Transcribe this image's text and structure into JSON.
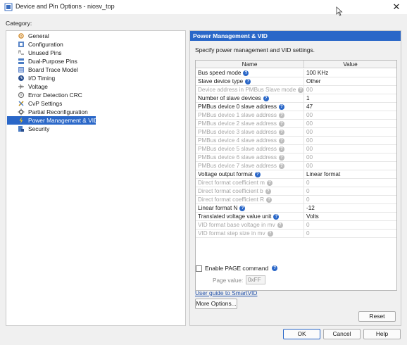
{
  "window": {
    "title": "Device and Pin Options - niosv_top",
    "close_glyph": "✕"
  },
  "category_label": "Category:",
  "tree": [
    {
      "label": "General",
      "icon": "general-icon",
      "selected": false
    },
    {
      "label": "Configuration",
      "icon": "configuration-icon",
      "selected": false
    },
    {
      "label": "Unused Pins",
      "icon": "unused-pins-icon",
      "selected": false
    },
    {
      "label": "Dual-Purpose Pins",
      "icon": "dual-purpose-pins-icon",
      "selected": false
    },
    {
      "label": "Board Trace Model",
      "icon": "board-trace-model-icon",
      "selected": false
    },
    {
      "label": "I/O Timing",
      "icon": "io-timing-icon",
      "selected": false
    },
    {
      "label": "Voltage",
      "icon": "voltage-icon",
      "selected": false
    },
    {
      "label": "Error Detection CRC",
      "icon": "error-detection-crc-icon",
      "selected": false
    },
    {
      "label": "CvP Settings",
      "icon": "cvp-settings-icon",
      "selected": false
    },
    {
      "label": "Partial Reconfiguration",
      "icon": "partial-reconfiguration-icon",
      "selected": false
    },
    {
      "label": "Power Management & VID",
      "icon": "power-management-icon",
      "selected": true
    },
    {
      "label": "Security",
      "icon": "security-icon",
      "selected": false
    }
  ],
  "panel": {
    "header": "Power Management & VID",
    "description": "Specify power management and VID settings.",
    "columns": {
      "name": "Name",
      "value": "Value"
    },
    "rows": [
      {
        "name": "Bus speed mode",
        "value": "100 KHz",
        "disabled": false
      },
      {
        "name": "Slave device type",
        "value": "Other",
        "disabled": false
      },
      {
        "name": "Device address in PMBus Slave mode",
        "value": "00",
        "disabled": true
      },
      {
        "name": "Number of slave devices",
        "value": "1",
        "disabled": false
      },
      {
        "name": "PMBus device 0 slave address",
        "value": "47",
        "disabled": false
      },
      {
        "name": "PMBus device 1 slave address",
        "value": "00",
        "disabled": true
      },
      {
        "name": "PMBus device 2 slave address",
        "value": "00",
        "disabled": true
      },
      {
        "name": "PMBus device 3 slave address",
        "value": "00",
        "disabled": true
      },
      {
        "name": "PMBus device 4 slave address",
        "value": "00",
        "disabled": true
      },
      {
        "name": "PMBus device 5 slave address",
        "value": "00",
        "disabled": true
      },
      {
        "name": "PMBus device 6 slave address",
        "value": "00",
        "disabled": true
      },
      {
        "name": "PMBus device 7 slave address",
        "value": "00",
        "disabled": true
      },
      {
        "name": "Voltage output format",
        "value": "Linear format",
        "disabled": false
      },
      {
        "name": "Direct format coefficient m",
        "value": "0",
        "disabled": true
      },
      {
        "name": "Direct format coefficient b",
        "value": "0",
        "disabled": true
      },
      {
        "name": "Direct format coefficient R",
        "value": "0",
        "disabled": true
      },
      {
        "name": "Linear format N",
        "value": "-12",
        "disabled": false
      },
      {
        "name": "Translated voltage value unit",
        "value": "Volts",
        "disabled": false
      },
      {
        "name": "VID format base voltage in mv",
        "value": "0",
        "disabled": true
      },
      {
        "name": "VID format step size in mv",
        "value": "0",
        "disabled": true
      }
    ],
    "enable_page_label": "Enable PAGE command",
    "page_value_label": "Page value:",
    "page_value": "0xFF",
    "guide_link": "User guide to SmartVID",
    "more_options": "More Options...",
    "reset": "Reset"
  },
  "footer": {
    "ok": "OK",
    "cancel": "Cancel",
    "help": "Help"
  },
  "colors": {
    "accent": "#2a67c8",
    "disabled_text": "#a6a6a6",
    "link": "#1f4fa8"
  }
}
